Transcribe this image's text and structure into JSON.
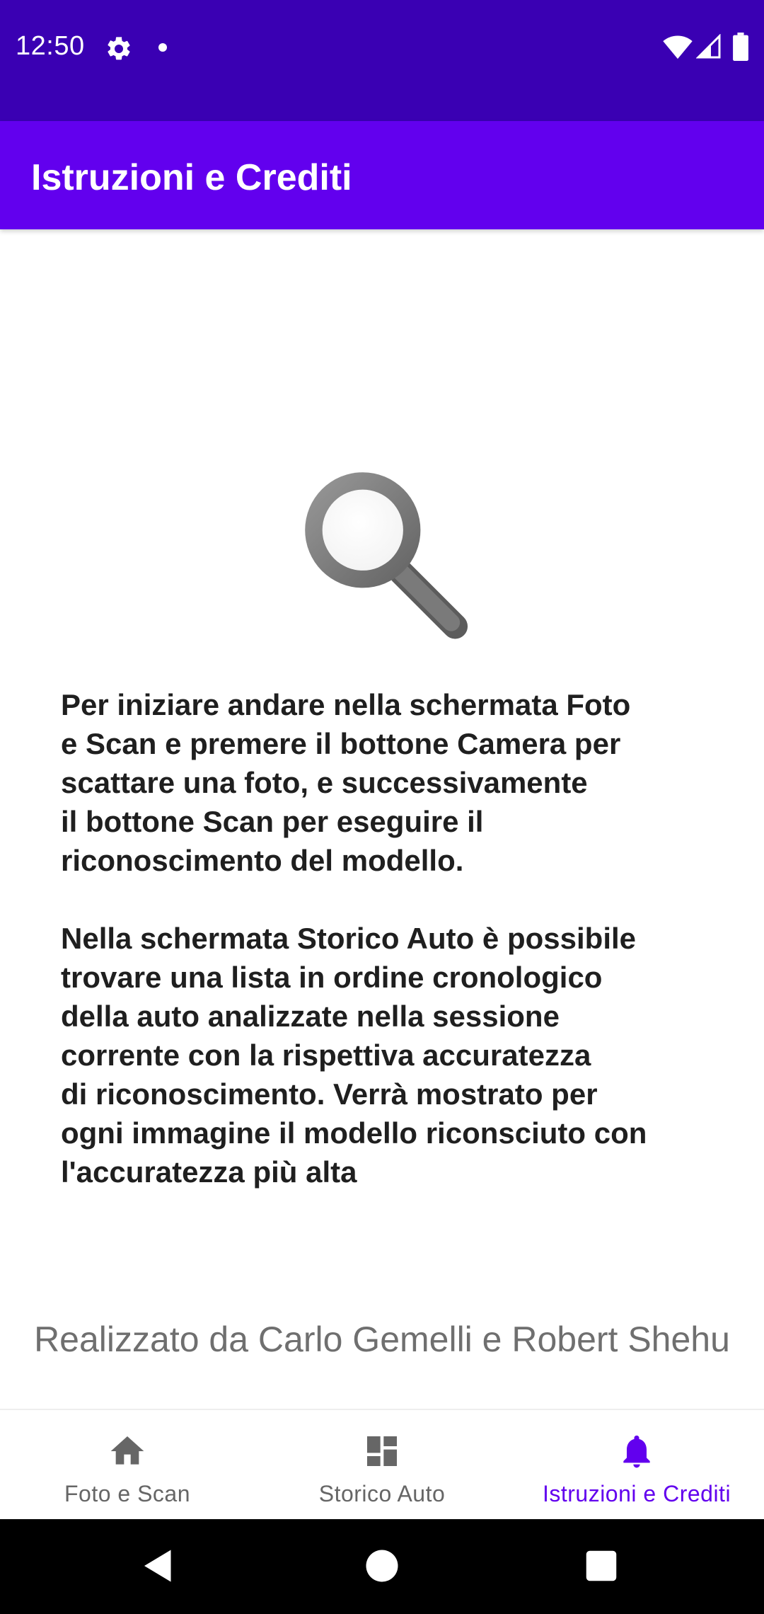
{
  "status_bar": {
    "time": "12:50",
    "icons": [
      "gear-icon",
      "notification-dot-icon",
      "wifi-icon",
      "cell-signal-icon",
      "battery-icon"
    ]
  },
  "app_bar": {
    "title": "Istruzioni e Crediti"
  },
  "content": {
    "image": "magnifying-glass-icon",
    "instructions": "Per iniziare andare nella schermata Foto\ne Scan e premere il bottone Camera per\nscattare una foto, e successivamente\nil bottone Scan per eseguire il\nriconoscimento del modello.\n\nNella schermata Storico Auto è possibile\ntrovare una lista in ordine cronologico\ndella auto analizzate nella sessione\ncorrente con la rispettiva accuratezza\ndi riconoscimento. Verrà mostrato per\nogni immagine il modello riconsciuto con\nl'accuratezza più alta",
    "credits": "Realizzato da Carlo Gemelli e Robert Shehu"
  },
  "bottom_nav": {
    "items": [
      {
        "label": "Foto e Scan",
        "icon": "home-icon",
        "active": false
      },
      {
        "label": "Storico Auto",
        "icon": "dashboard-icon",
        "active": false
      },
      {
        "label": "Istruzioni e Crediti",
        "icon": "bell-icon",
        "active": true
      }
    ]
  },
  "system_nav": {
    "buttons": [
      "back-icon",
      "home-circle-icon",
      "recents-icon"
    ]
  },
  "colors": {
    "status_bar": "#3a00b3",
    "primary": "#6200ee",
    "inactive_nav": "#666666",
    "text": "#1f1f1f",
    "credits_text": "#6f6f6f"
  }
}
